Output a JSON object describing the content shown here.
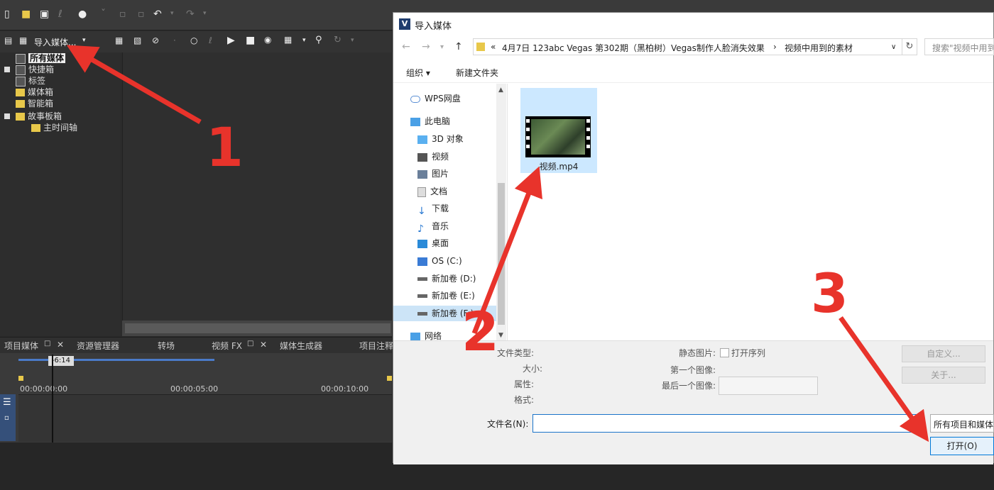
{
  "vegas": {
    "import_label": "导入媒体...",
    "tree": [
      "所有媒体",
      "快捷箱",
      "标签",
      "媒体箱",
      "智能箱",
      "故事板箱",
      "主时间轴"
    ],
    "tabs": [
      "项目媒体",
      "资源管理器",
      "转场",
      "视频 FX",
      "媒体生成器",
      "项目注释"
    ],
    "timecode_badge": "-6:14",
    "ruler": [
      "00:00:00:00",
      "00:00:05:00",
      "00:00:10:00"
    ]
  },
  "dialog": {
    "title": "导入媒体",
    "path": [
      "«",
      "4月7日 123abc Vegas 第302期（黑柏树）Vegas制作人脸消失效果",
      "›",
      "视频中用到的素材"
    ],
    "search_placeholder": "搜索\"视频中用到...",
    "organize": "组织 ▾",
    "new_folder": "新建文件夹",
    "nav": {
      "wps": "WPS网盘",
      "this_pc": "此电脑",
      "items": [
        "3D 对象",
        "视频",
        "图片",
        "文档",
        "下载",
        "音乐",
        "桌面",
        "OS (C:)",
        "新加卷 (D:)",
        "新加卷 (E:)",
        "新加卷 (F:)"
      ],
      "network": "网络"
    },
    "file": {
      "name": "视频.mp4"
    },
    "details": {
      "file_type": "文件类型:",
      "size": "大小:",
      "properties": "属性:",
      "attributes": "格式:",
      "still_image": "静态图片:",
      "open_sequence": "打开序列",
      "first_image": "第一个图像:",
      "last_image": "最后一个图像:",
      "customize_btn": "自定义...",
      "open_btn_top": "关于..."
    },
    "filename_label": "文件名(N):",
    "filename_value": "",
    "filter": "所有项目和媒体",
    "open": "打开(O)"
  },
  "annotations": {
    "one": "1",
    "two": "2",
    "three": "3",
    "arrow_color": "#e8332b"
  }
}
